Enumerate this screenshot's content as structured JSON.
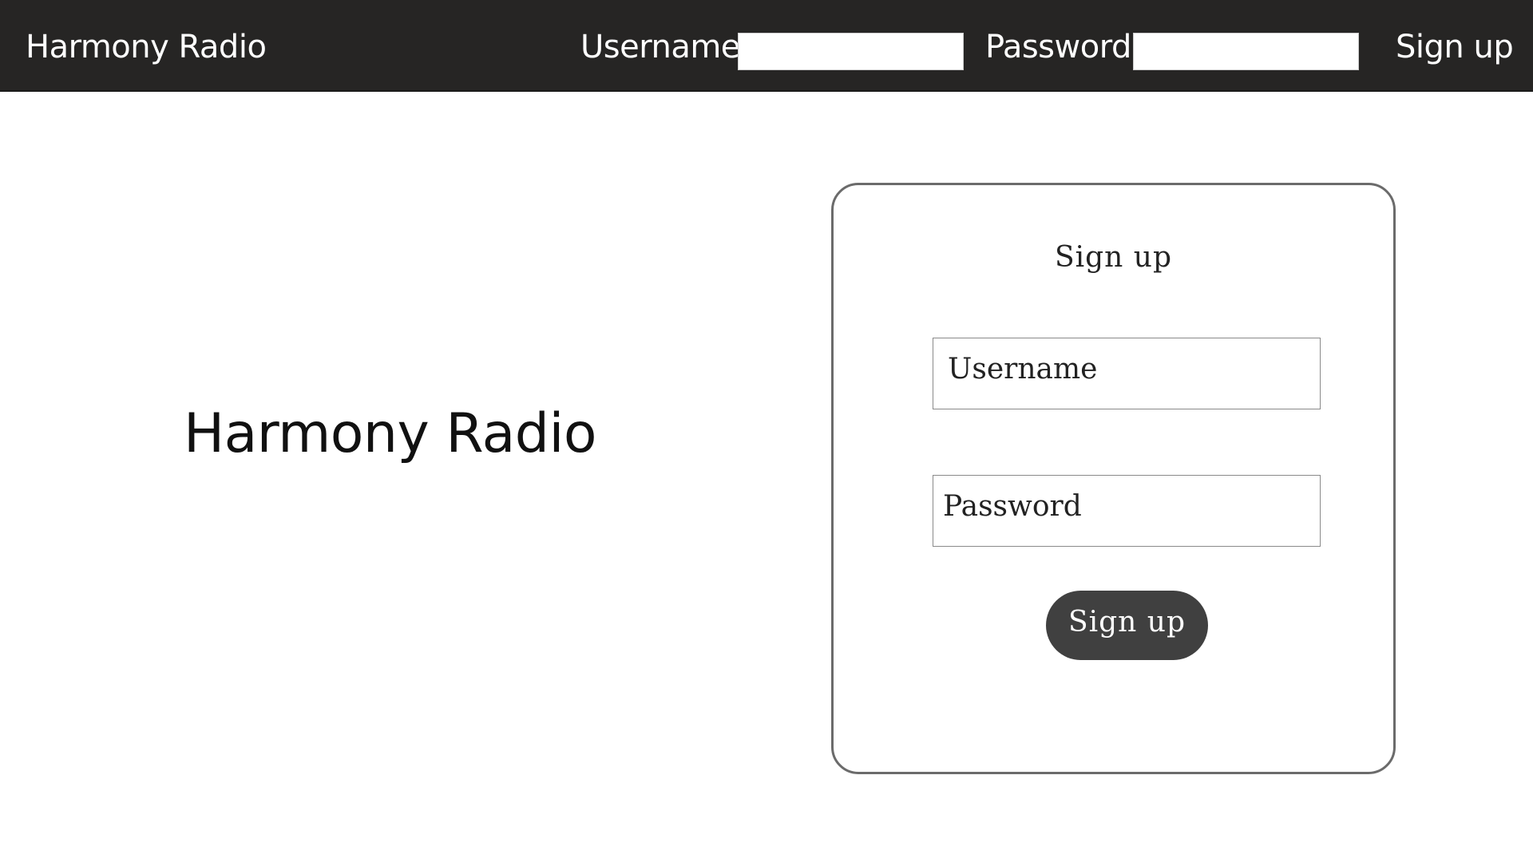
{
  "header": {
    "brand": "Harmony Radio",
    "username_label": "Username",
    "username_value": "",
    "password_label": "Password",
    "password_value": "",
    "signup_link": "Sign up"
  },
  "hero": {
    "title": "Harmony Radio"
  },
  "signup_card": {
    "title": "Sign up",
    "username_placeholder": "Username",
    "password_placeholder": "Password",
    "submit_label": "Sign up"
  },
  "colors": {
    "header_background": "#262524",
    "button_background": "#404040",
    "card_border": "#6b6b6b"
  }
}
